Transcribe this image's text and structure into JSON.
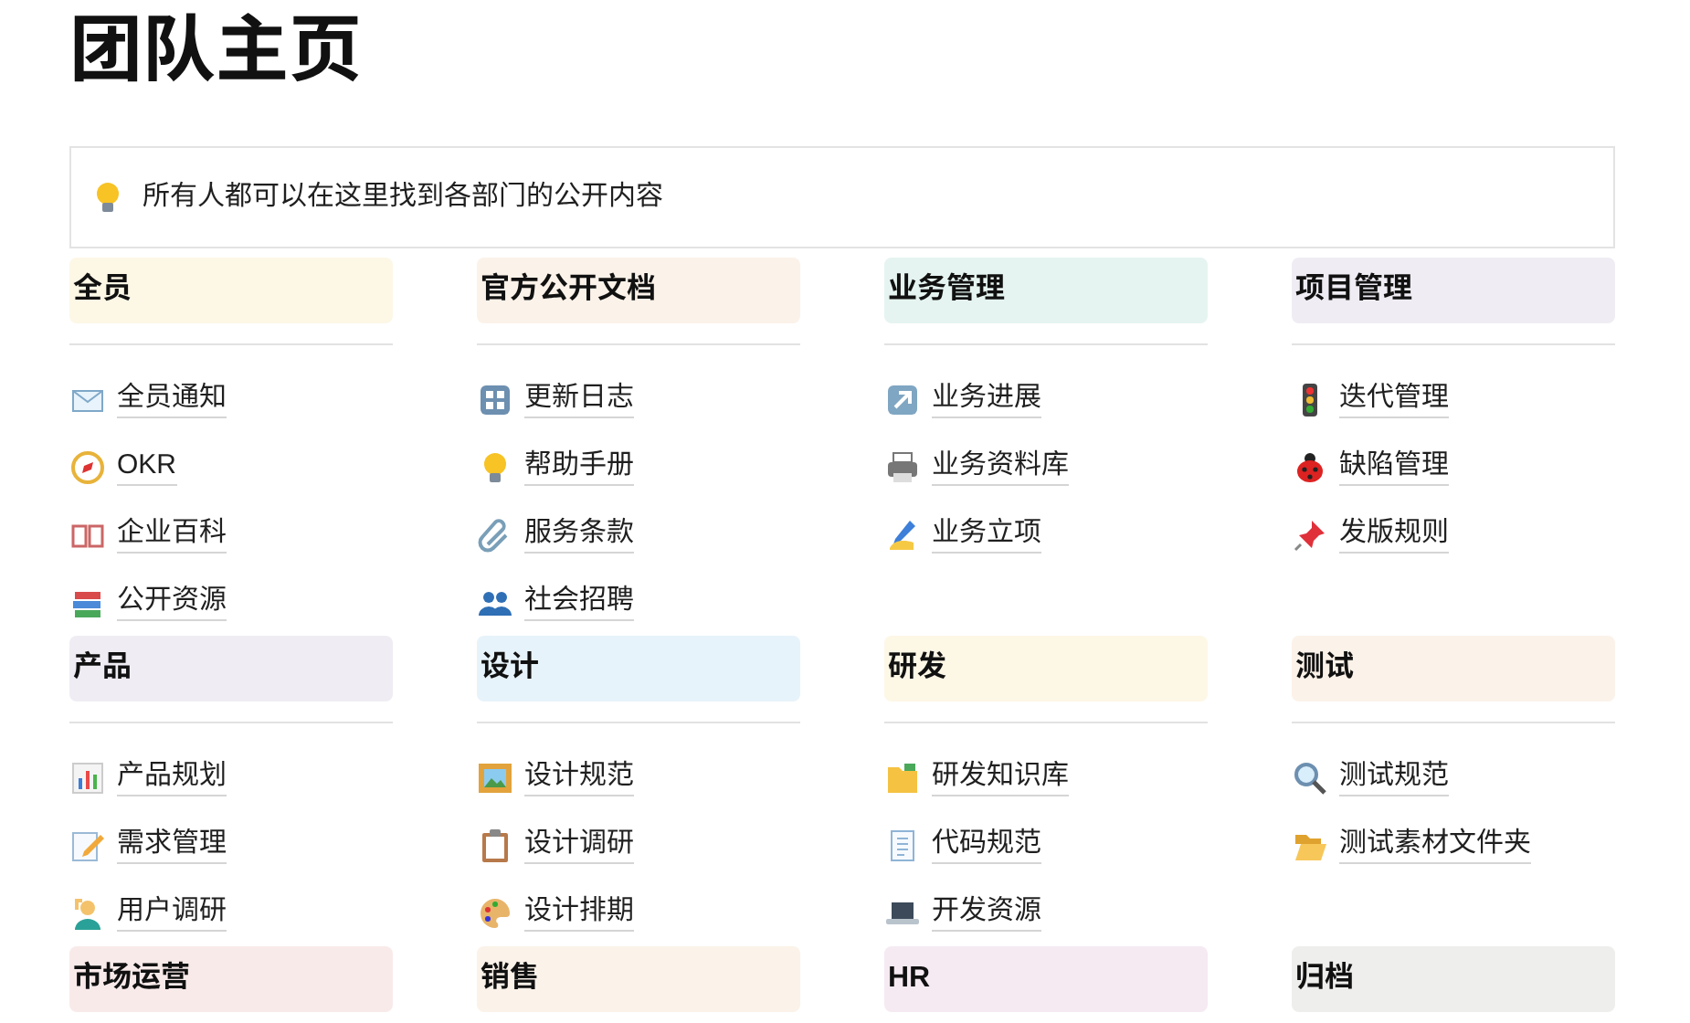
{
  "title": "团队主页",
  "callout": {
    "text": "所有人都可以在这里找到各部门的公开内容"
  },
  "sections": [
    {
      "title": "全员",
      "color": "#fdf7e6",
      "items": [
        "全员通知",
        "OKR",
        "企业百科",
        "公开资源"
      ]
    },
    {
      "title": "官方公开文档",
      "color": "#fbf2e9",
      "items": [
        "更新日志",
        "帮助手册",
        "服务条款",
        "社会招聘"
      ]
    },
    {
      "title": "业务管理",
      "color": "#e5f4f0",
      "items": [
        "业务进展",
        "业务资料库",
        "业务立项"
      ]
    },
    {
      "title": "项目管理",
      "color": "#efecf3",
      "items": [
        "迭代管理",
        "缺陷管理",
        "发版规则"
      ]
    },
    {
      "title": "产品",
      "color": "#efecf3",
      "items": [
        "产品规划",
        "需求管理",
        "用户调研"
      ]
    },
    {
      "title": "设计",
      "color": "#e7f3fa",
      "items": [
        "设计规范",
        "设计调研",
        "设计排期"
      ]
    },
    {
      "title": "研发",
      "color": "#fdf7e6",
      "items": [
        "研发知识库",
        "代码规范",
        "开发资源"
      ]
    },
    {
      "title": "测试",
      "color": "#fbf2e9",
      "items": [
        "测试规范",
        "测试素材文件夹"
      ]
    },
    {
      "title": "市场运营",
      "color": "#f9eaea"
    },
    {
      "title": "销售",
      "color": "#fbf2e9"
    },
    {
      "title": "HR",
      "color": "#f5eaf2"
    },
    {
      "title": "归档",
      "color": "#eeeeec"
    }
  ]
}
